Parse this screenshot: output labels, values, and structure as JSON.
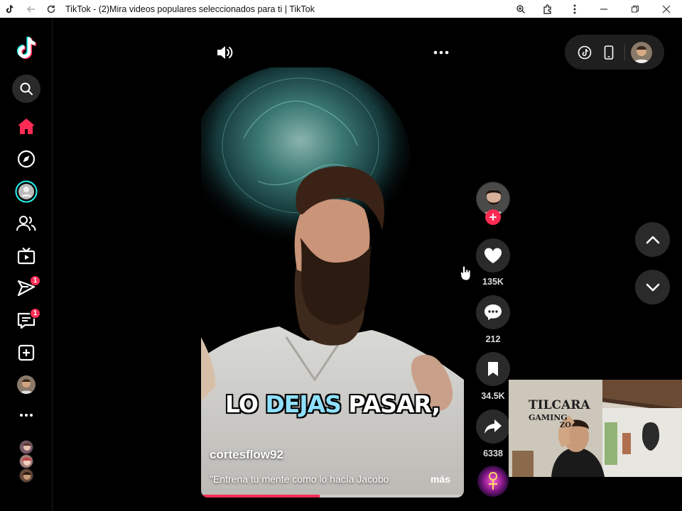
{
  "browser": {
    "title": "TikTok - (2)Mira videos populares seleccionados para ti | TikTok"
  },
  "sidebar": {
    "items": [
      {
        "name": "search",
        "icon": "search-icon"
      },
      {
        "name": "home",
        "icon": "home-icon",
        "active": true
      },
      {
        "name": "explore",
        "icon": "compass-icon"
      },
      {
        "name": "live",
        "icon": "live-avatar-icon"
      },
      {
        "name": "following",
        "icon": "users-icon"
      },
      {
        "name": "live-tv",
        "icon": "tv-icon"
      },
      {
        "name": "messages",
        "icon": "send-icon",
        "badge": "1"
      },
      {
        "name": "activity",
        "icon": "inbox-icon",
        "badge": "1"
      },
      {
        "name": "upload",
        "icon": "plus-square-icon"
      },
      {
        "name": "profile",
        "icon": "avatar"
      },
      {
        "name": "more",
        "icon": "more-horizontal-icon"
      }
    ]
  },
  "video": {
    "caption_parts": [
      "LO ",
      "DEJAS",
      " PASAR,"
    ],
    "author": "cortesflow92",
    "description": "\"Entrena tu mente como lo hacía Jacobo",
    "more_label": "más",
    "progress": 0.45
  },
  "actions": {
    "likes": "135K",
    "comments": "212",
    "saves": "34.5K",
    "shares": "6338"
  },
  "webcam": {
    "sign_line1": "TILCARA",
    "sign_line2": "GAMING",
    "sign_line3": "ZO"
  },
  "colors": {
    "brand_accent": "#fe2c55",
    "caption_highlight": "#8fe0ff",
    "background": "#000000"
  }
}
